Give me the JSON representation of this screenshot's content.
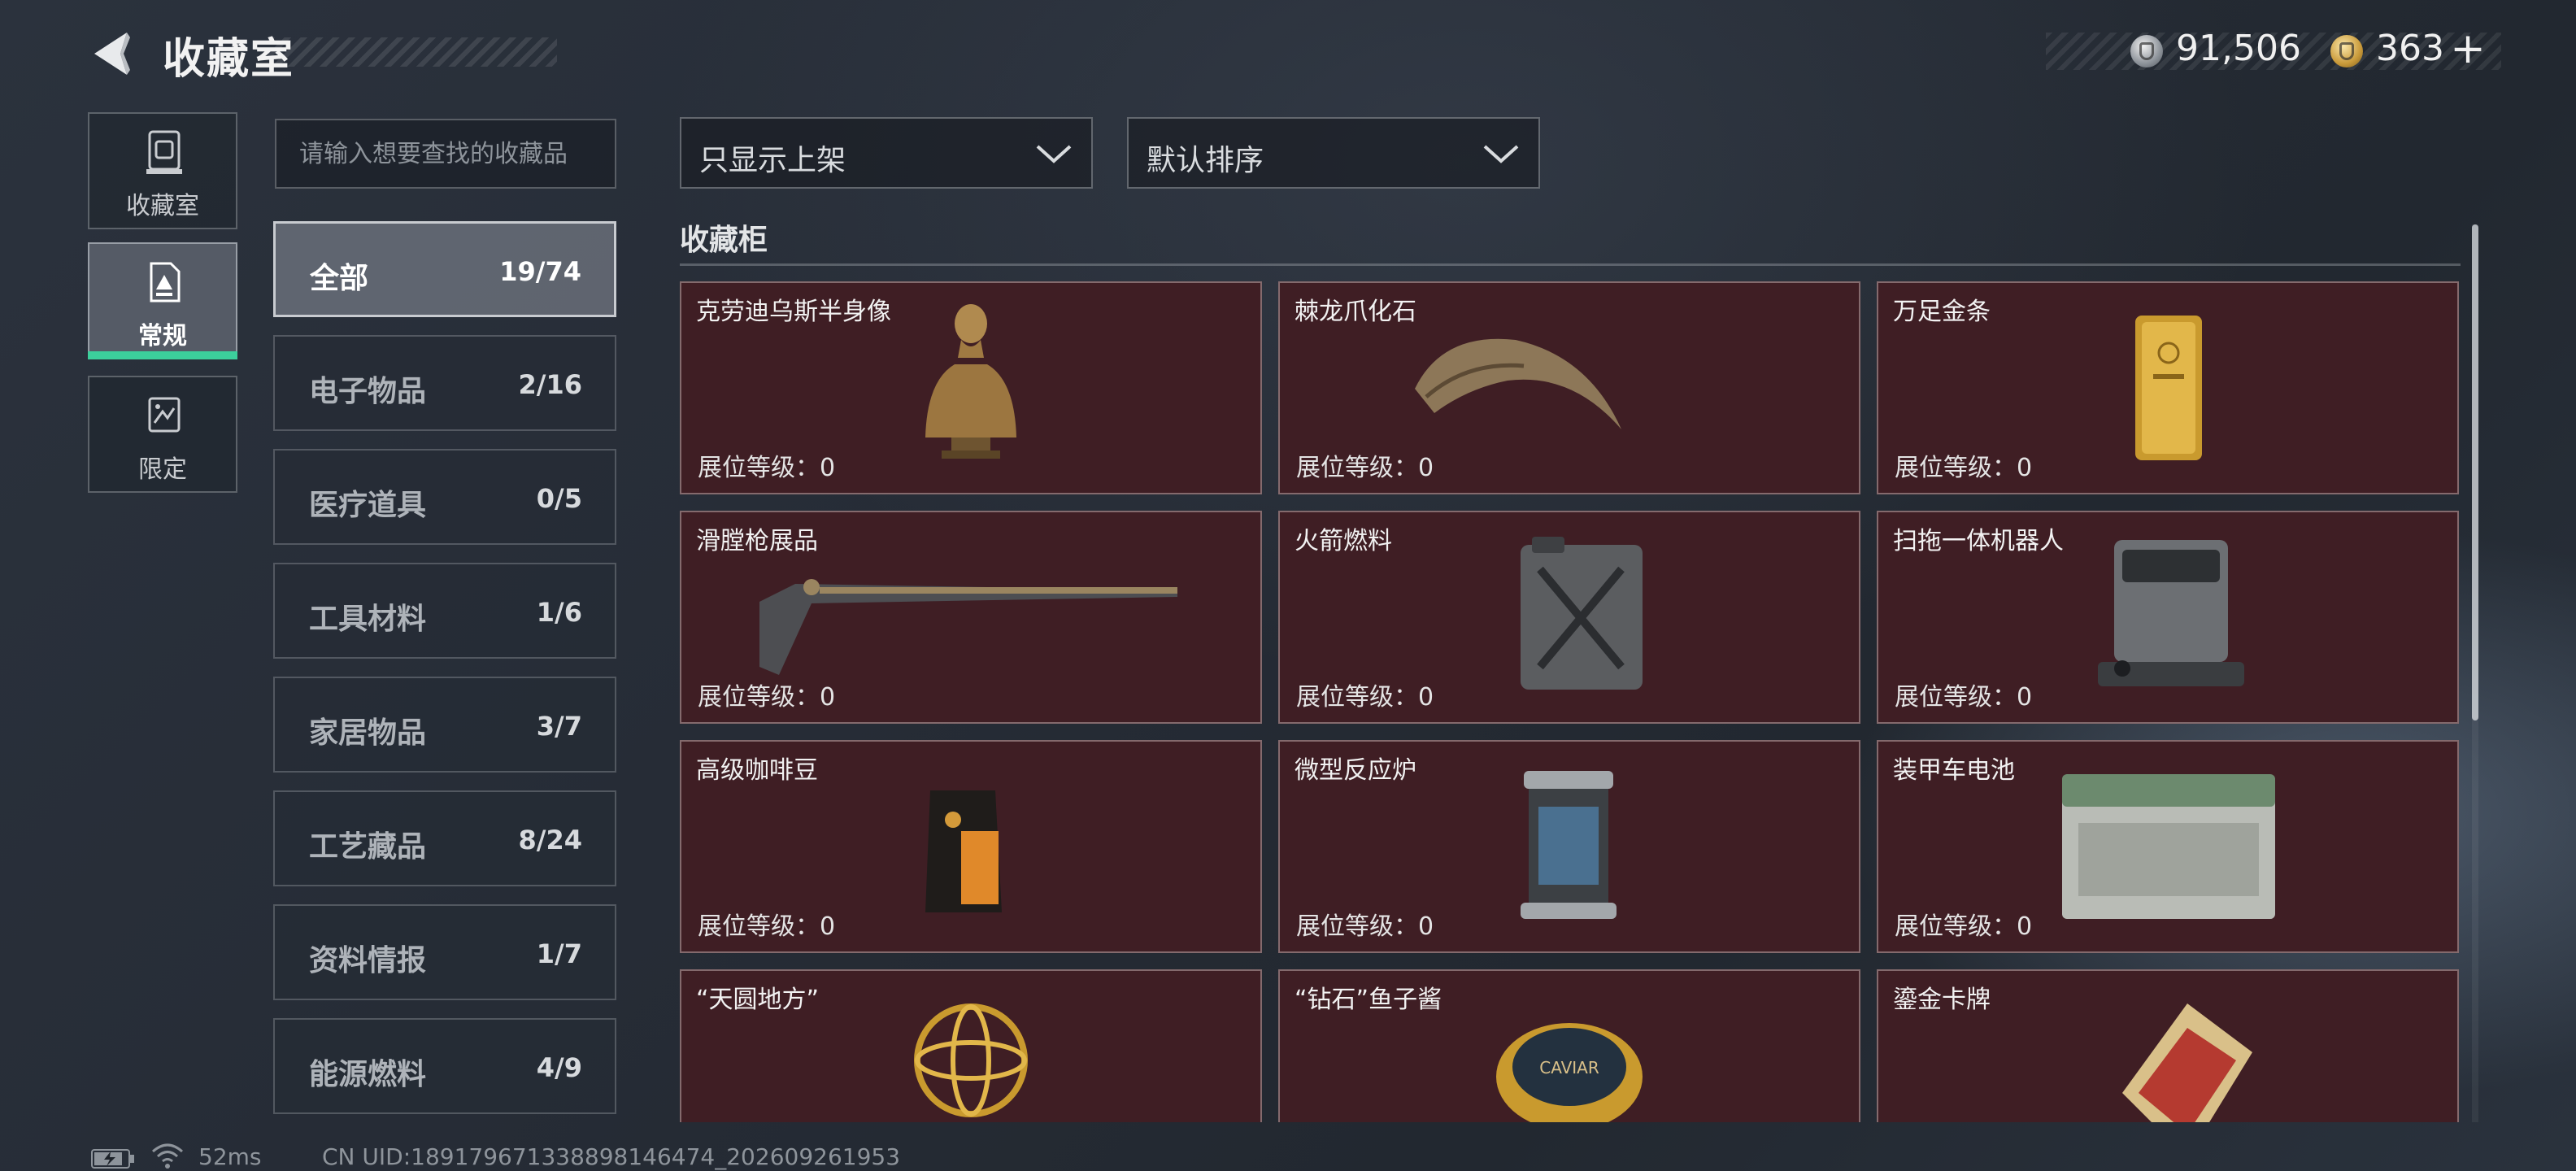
{
  "header": {
    "title": "收藏室",
    "currency": [
      {
        "name": "silver-coin",
        "amount": "91,506"
      },
      {
        "name": "gold-coin",
        "amount": "363"
      }
    ],
    "add_label": "+"
  },
  "rail": {
    "items": [
      {
        "label": "收藏室",
        "icon": "collection-room-icon"
      },
      {
        "label": "常规",
        "icon": "regular-icon",
        "selected": true
      },
      {
        "label": "限定",
        "icon": "limited-icon"
      }
    ]
  },
  "search": {
    "placeholder": "请输入想要查找的收藏品"
  },
  "categories": [
    {
      "name": "全部",
      "count": "19/74",
      "selected": true
    },
    {
      "name": "电子物品",
      "count": "2/16"
    },
    {
      "name": "医疗道具",
      "count": "0/5"
    },
    {
      "name": "工具材料",
      "count": "1/6"
    },
    {
      "name": "家居物品",
      "count": "3/7"
    },
    {
      "name": "工艺藏品",
      "count": "8/24"
    },
    {
      "name": "资料情报",
      "count": "1/7"
    },
    {
      "name": "能源燃料",
      "count": "4/9"
    }
  ],
  "filters": {
    "show_filter": "只显示上架",
    "sort": "默认排序"
  },
  "section": {
    "title": "收藏柜"
  },
  "items": [
    {
      "title": "克劳迪乌斯半身像",
      "level": "展位等级：0",
      "icon": "bust-statue-icon"
    },
    {
      "title": "棘龙爪化石",
      "level": "展位等级：0",
      "icon": "claw-fossil-icon"
    },
    {
      "title": "万足金条",
      "level": "展位等级：0",
      "icon": "gold-bar-icon"
    },
    {
      "title": "滑膛枪展品",
      "level": "展位等级：0",
      "icon": "musket-icon"
    },
    {
      "title": "火箭燃料",
      "level": "展位等级：0",
      "icon": "fuel-canister-icon"
    },
    {
      "title": "扫拖一体机器人",
      "level": "展位等级：0",
      "icon": "robot-vacuum-icon"
    },
    {
      "title": "高级咖啡豆",
      "level": "展位等级：0",
      "icon": "coffee-bag-icon"
    },
    {
      "title": "微型反应炉",
      "level": "展位等级：0",
      "icon": "reactor-icon"
    },
    {
      "title": "装甲车电池",
      "level": "展位等级：0",
      "icon": "battery-box-icon"
    },
    {
      "title": "“天圆地方”",
      "level": "",
      "icon": "armillary-sphere-icon"
    },
    {
      "title": "“钻石”鱼子酱",
      "level": "",
      "icon": "caviar-tin-icon"
    },
    {
      "title": "鎏金卡牌",
      "level": "",
      "icon": "gilded-card-icon"
    }
  ],
  "caviar_label": "CAVIAR",
  "footer": {
    "ping": "52ms",
    "uid": "CN UID:18917967133889814​6474_202609261953"
  },
  "colors": {
    "accent": "#3ccf9b",
    "card_bg": "#3f1e24",
    "page_bg": "#262c36"
  }
}
